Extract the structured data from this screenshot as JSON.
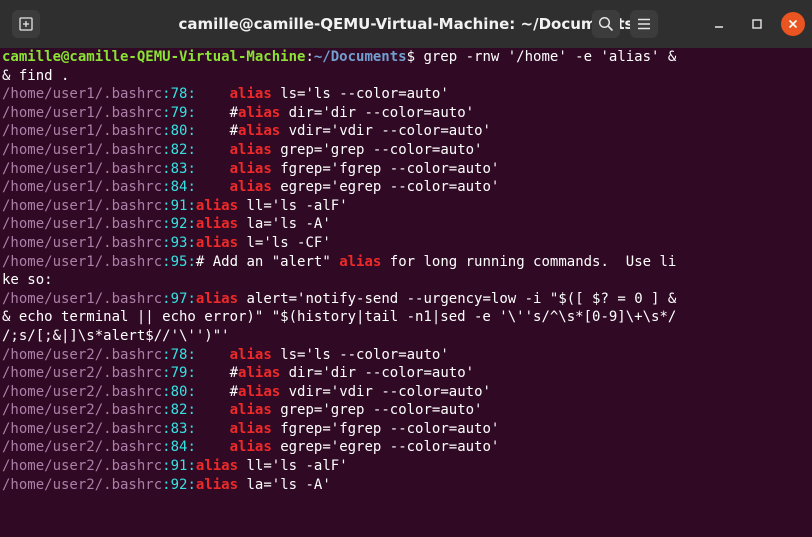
{
  "window": {
    "title": "camille@camille-QEMU-Virtual-Machine: ~/Documents",
    "colors": {
      "titlebar": "#2f2f2f",
      "terminal_bg": "#300a24",
      "close_button": "#e95420"
    }
  },
  "prompt": {
    "user_host": "camille@camille-QEMU-Virtual-Machine",
    "separator": ":",
    "path": "~/Documents",
    "symbol": "$ ",
    "command": "grep -rnw '/home' -e 'alias' &",
    "command_wrap": "& find ."
  },
  "colors": {
    "user_host": "#8ae234",
    "path": "#729fcf",
    "filename": "#ad7fa8",
    "line_number": "#34e2e2",
    "match": "#ef2929",
    "text": "#ffffff"
  },
  "results": [
    {
      "file": "/home/user1/.bashrc",
      "line": "78",
      "pre": "    ",
      "match": "alias",
      "post": " ls='ls --color=auto'"
    },
    {
      "file": "/home/user1/.bashrc",
      "line": "79",
      "pre": "    #",
      "match": "alias",
      "post": " dir='dir --color=auto'"
    },
    {
      "file": "/home/user1/.bashrc",
      "line": "80",
      "pre": "    #",
      "match": "alias",
      "post": " vdir='vdir --color=auto'"
    },
    {
      "file": "/home/user1/.bashrc",
      "line": "82",
      "pre": "    ",
      "match": "alias",
      "post": " grep='grep --color=auto'"
    },
    {
      "file": "/home/user1/.bashrc",
      "line": "83",
      "pre": "    ",
      "match": "alias",
      "post": " fgrep='fgrep --color=auto'"
    },
    {
      "file": "/home/user1/.bashrc",
      "line": "84",
      "pre": "    ",
      "match": "alias",
      "post": " egrep='egrep --color=auto'"
    },
    {
      "file": "/home/user1/.bashrc",
      "line": "91",
      "pre": "",
      "match": "alias",
      "post": " ll='ls -alF'"
    },
    {
      "file": "/home/user1/.bashrc",
      "line": "92",
      "pre": "",
      "match": "alias",
      "post": " la='ls -A'"
    },
    {
      "file": "/home/user1/.bashrc",
      "line": "93",
      "pre": "",
      "match": "alias",
      "post": " l='ls -CF'"
    },
    {
      "file": "/home/user1/.bashrc",
      "line": "95",
      "pre": "# Add an \"alert\" ",
      "match": "alias",
      "post": " for long running commands.  Use li",
      "wrap": [
        "ke so:"
      ]
    },
    {
      "file": "/home/user1/.bashrc",
      "line": "97",
      "pre": "",
      "match": "alias",
      "post": " alert='notify-send --urgency=low -i \"$([ $? = 0 ] &",
      "wrap": [
        "& echo terminal || echo error)\" \"$(history|tail -n1|sed -e '\\''s/^\\s*[0-9]\\+\\s*/",
        "/;s/[;&|]\\s*alert$//'\\'')\"'"
      ]
    },
    {
      "file": "/home/user2/.bashrc",
      "line": "78",
      "pre": "    ",
      "match": "alias",
      "post": " ls='ls --color=auto'"
    },
    {
      "file": "/home/user2/.bashrc",
      "line": "79",
      "pre": "    #",
      "match": "alias",
      "post": " dir='dir --color=auto'"
    },
    {
      "file": "/home/user2/.bashrc",
      "line": "80",
      "pre": "    #",
      "match": "alias",
      "post": " vdir='vdir --color=auto'"
    },
    {
      "file": "/home/user2/.bashrc",
      "line": "82",
      "pre": "    ",
      "match": "alias",
      "post": " grep='grep --color=auto'"
    },
    {
      "file": "/home/user2/.bashrc",
      "line": "83",
      "pre": "    ",
      "match": "alias",
      "post": " fgrep='fgrep --color=auto'"
    },
    {
      "file": "/home/user2/.bashrc",
      "line": "84",
      "pre": "    ",
      "match": "alias",
      "post": " egrep='egrep --color=auto'"
    },
    {
      "file": "/home/user2/.bashrc",
      "line": "91",
      "pre": "",
      "match": "alias",
      "post": " ll='ls -alF'"
    },
    {
      "file": "/home/user2/.bashrc",
      "line": "92",
      "pre": "",
      "match": "alias",
      "post": " la='ls -A'"
    }
  ],
  "icons": {
    "new_tab": "new-tab-icon",
    "search": "search-icon",
    "menu": "hamburger-menu-icon",
    "minimize": "minimize-icon",
    "maximize": "maximize-icon",
    "close": "close-icon"
  }
}
